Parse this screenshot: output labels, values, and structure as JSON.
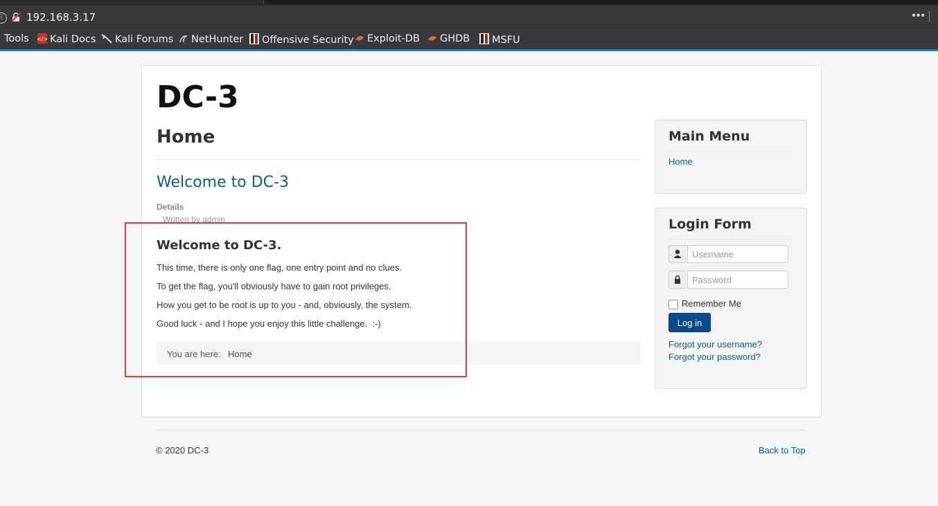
{
  "browser": {
    "url": "192.168.3.17",
    "more_menu": "•••",
    "bookmarks": [
      "Tools",
      "Kali Docs",
      "Kali Forums",
      "NetHunter",
      "Offensive Security",
      "Exploit-DB",
      "GHDB",
      "MSFU"
    ]
  },
  "site": {
    "title": "DC-3",
    "page_heading": "Home"
  },
  "article": {
    "title": "Welcome to DC-3",
    "details_label": "Details",
    "written_by": "Written by admin",
    "heading": "Welcome to DC-3.",
    "paragraphs": [
      "This time, there is only one flag, one entry point and no clues.",
      "To get the flag, you'll obviously have to gain root privileges.",
      "How you get to be root is up to you - and, obviously, the system.",
      "Good luck - and I hope you enjoy this little challenge.  :-)"
    ]
  },
  "breadcrumb": {
    "label": "You are here:",
    "current": "Home"
  },
  "main_menu": {
    "title": "Main Menu",
    "items": [
      "Home"
    ]
  },
  "login_form": {
    "title": "Login Form",
    "username_placeholder": "Username",
    "password_placeholder": "Password",
    "remember_label": "Remember Me",
    "remember_checked": false,
    "login_button": "Log in",
    "forgot_username": "Forgot your username?",
    "forgot_password": "Forgot your password?"
  },
  "footer": {
    "copyright": "© 2020 DC-3",
    "back_to_top": "Back to Top"
  },
  "colors": {
    "link": "#0b5c91",
    "button": "#0a4a8f",
    "annotation": "#e03c3c",
    "browser_accent": "#0a84ff"
  }
}
